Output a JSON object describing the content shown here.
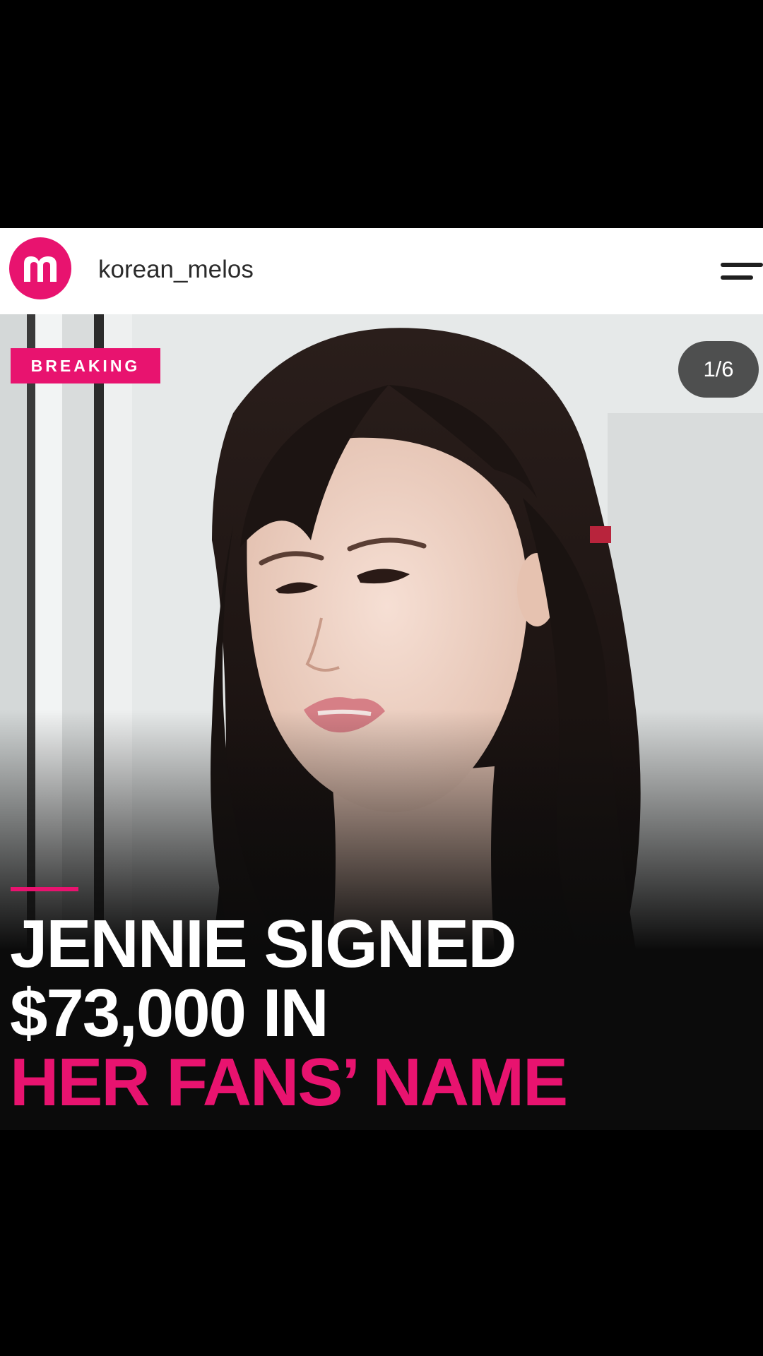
{
  "post": {
    "username": "korean_melos",
    "avatar_letter": "m",
    "badge": "BREAKING",
    "slide_counter": "1/6",
    "headline": {
      "line1": "JENNIE SIGNED",
      "line2": "$73,000 IN",
      "line3": "HER FANS’ NAME"
    }
  },
  "icons": {
    "menu": "menu-icon",
    "avatar": "brand-logo-icon"
  },
  "colors": {
    "accent": "#e8136f",
    "background": "#000000",
    "header_bg": "#ffffff",
    "headline_white": "#ffffff"
  }
}
